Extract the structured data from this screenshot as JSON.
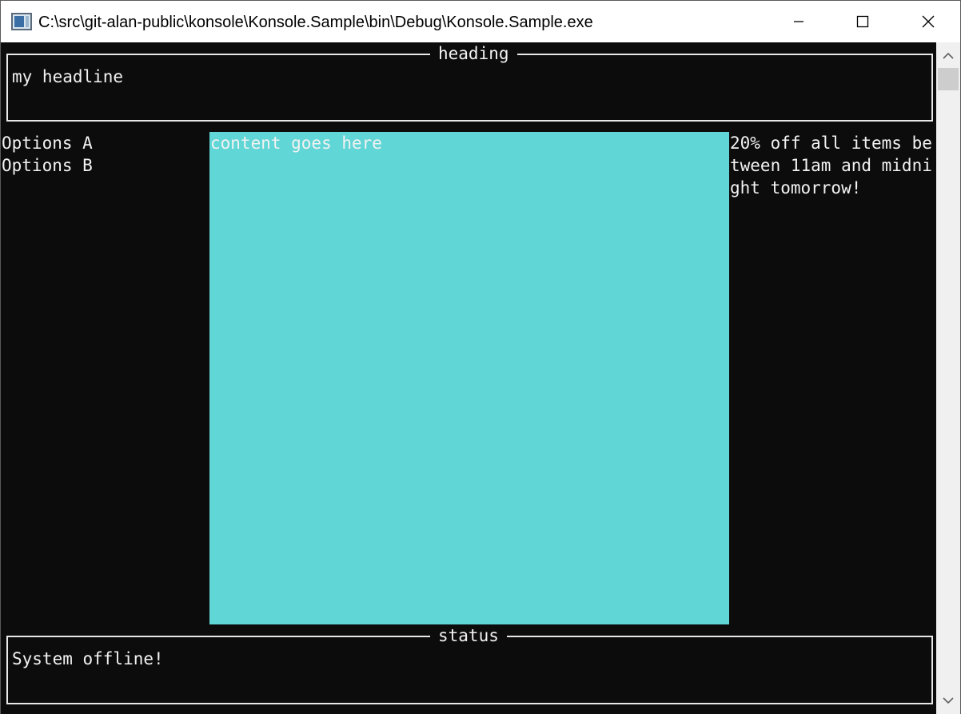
{
  "window": {
    "title": "C:\\src\\git-alan-public\\konsole\\Konsole.Sample\\bin\\Debug\\Konsole.Sample.exe",
    "icon": "console-app-icon",
    "controls": [
      "minimize-icon",
      "maximize-icon",
      "close-icon"
    ]
  },
  "heading_box": {
    "title": "heading",
    "text": "my headline"
  },
  "sidebar": {
    "items": [
      {
        "label": "Options A"
      },
      {
        "label": "Options B"
      }
    ]
  },
  "content": {
    "text": "content goes here",
    "background": "#61d6d6"
  },
  "promo": {
    "lines": [
      "20% off all items be",
      "tween 11am and midni",
      "ght tomorrow!"
    ]
  },
  "status_box": {
    "title": "status",
    "text": "System offline!"
  },
  "colors": {
    "terminal_bg": "#0c0c0c",
    "text": "#f2f2f2",
    "accent_cyan": "#61d6d6"
  }
}
